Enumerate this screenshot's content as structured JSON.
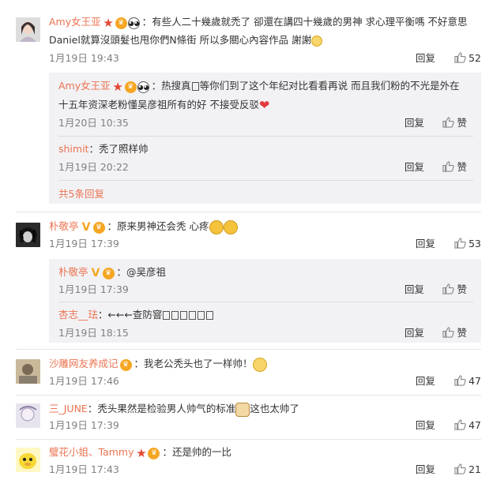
{
  "comments": [
    {
      "user": "Amy女王亚",
      "text_1": "：有些人二十幾歲就禿了 卻還在講四十幾歲的男神 求心理平衡嗎 不好意思",
      "text_2": "Daniel就算沒頭髮也甩你們N條街 所以多關心內容作品 謝謝",
      "time": "1月19日 19:43",
      "reply_label": "回复",
      "likes": "52",
      "replies": [
        {
          "user": "Amy女王亚",
          "text_1": "：热搜真",
          "text_1b": "等你们到了这个年纪对比看看再说 而且我们粉的不光是外在",
          "text_2": "十五年资深老粉懂吴彦祖所有的好 不接受反驳",
          "time": "1月20日 10:35",
          "reply_label": "回复",
          "like_label": "赞"
        },
        {
          "user": "shimit",
          "text_1": "：秃了照样帅",
          "time": "1月19日 20:22",
          "reply_label": "回复",
          "like_label": "赞"
        }
      ],
      "more_label": "共5条回复"
    },
    {
      "user": "朴敬亭",
      "text_1": "：原来男神还会秃 心疼",
      "time": "1月19日 17:39",
      "reply_label": "回复",
      "likes": "53",
      "replies": [
        {
          "user": "朴敬亭",
          "text_1": "：@吴彦祖",
          "time": "1月19日 17:39",
          "reply_label": "回复",
          "like_label": "赞"
        },
        {
          "user": "杏志__珐",
          "text_1": "：←←←查防窨",
          "time": "1月19日 18:15",
          "reply_label": "回复",
          "like_label": "赞"
        }
      ]
    },
    {
      "user": "沙雕网友养成记",
      "text_1": "：我老公秃头也了一样帅！",
      "time": "1月19日 17:46",
      "reply_label": "回复",
      "likes": "47"
    },
    {
      "user": "三_JUNE",
      "text_1": "：秃头果然是检验男人帅气的标准",
      "text_1b": "这也太帅了",
      "time": "1月19日 17:39",
      "reply_label": "回复",
      "likes": "47"
    },
    {
      "user": "璧花小姐、Tammy",
      "text_1": "：还是帅的一比",
      "time": "1月19日 17:43",
      "reply_label": "回复",
      "likes": "21"
    }
  ],
  "colors": {
    "username": "#eb7350",
    "subbox": "#f2f2f5",
    "meta": "#808080"
  }
}
